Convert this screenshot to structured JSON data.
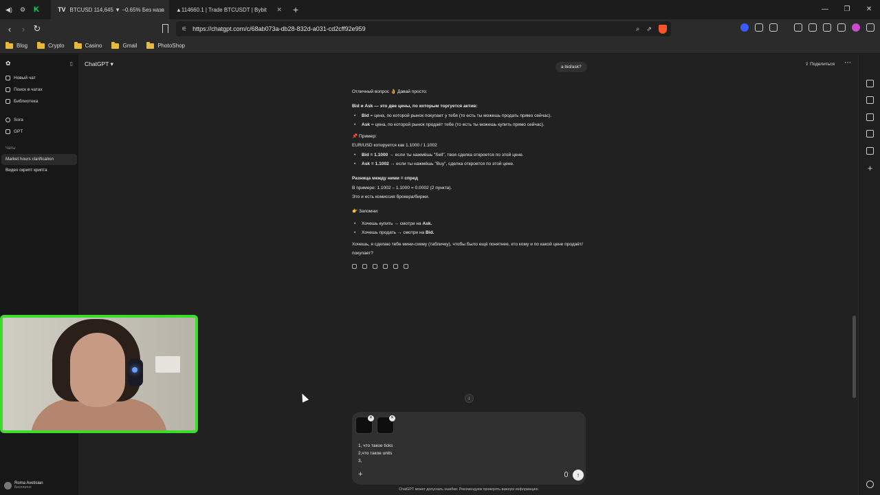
{
  "browser": {
    "tabs": [
      {
        "title": "BTCUSD 114,645 ▼ −0.65% Без назв",
        "icon": "tradingview-icon",
        "fav": "TV"
      },
      {
        "title": "▲114660.1 | Trade BTCUSDT | Bybit",
        "icon": "bybit-icon",
        "fav": ""
      }
    ],
    "url": "https://chatgpt.com/c/68ab073a-db28-832d-a031-cd2cff92e959",
    "bookmarks": [
      "Blog",
      "Crypto",
      "Casino",
      "Gmail",
      "PhotoShop"
    ],
    "window_controls": [
      "—",
      "❐",
      "✕"
    ]
  },
  "sidebar": {
    "items": [
      "Новый чат",
      "Поиск в чатах",
      "Библиотека"
    ],
    "projects": [
      "Sora",
      "GPT"
    ],
    "chats_heading": "Чаты",
    "chats": [
      "Market hours clarification",
      "Видео скрипт крипта"
    ],
    "user": {
      "name": "Roma Avetisian",
      "plan": "Бесплатно"
    }
  },
  "header": {
    "model": "ChatGPT ▾",
    "share": "⇪ Поделиться",
    "more": "⋯"
  },
  "conversation": {
    "user_message": "a bid/ask?",
    "answer": {
      "intro": "Отличный вопрос 👌 Давай просто:",
      "heading1": "Bid и Ask — это две цены, по которым торгуется актив:",
      "defs": [
        {
          "term": "Bid",
          "text": " = цена, по которой рынок покупает у тебя (то есть ты можешь продать прямо сейчас)."
        },
        {
          "term": "Ask",
          "text": " = цена, по которой рынок продаёт тебе (то есть ты можешь купить прямо сейчас)."
        }
      ],
      "example_label": "📌 Пример:",
      "example_line": "EUR/USD котируется как 1.1000 / 1.1002",
      "examples": [
        {
          "term": "Bid = 1.1000",
          "text": " → если ты нажмёшь \"Sell\", твоя сделка откроется по этой цене."
        },
        {
          "term": "Ask = 1.1002",
          "text": " → если ты нажмёшь \"Buy\", сделка откроется по этой цене."
        }
      ],
      "heading2": "Разница между ними = спред",
      "spread_line1": "В примере: 1.1002 – 1.1000 = 0.0002 (2 пункта).",
      "spread_line2": "Это и есть комиссия брокера/биржи.",
      "remember_label": "👉 Запомни:",
      "remember": [
        {
          "text": "Хочешь купить → смотри на ",
          "term": "Ask."
        },
        {
          "text": "Хочешь продать → смотри на ",
          "term": "Bid."
        }
      ],
      "offer": "Хочешь, я сделаю тебе мини-схему (табличку), чтобы было ещё понятнее, кто кому и по какой цене продаёт/покупает?"
    }
  },
  "composer": {
    "lines": [
      "1, что такое ticks",
      "2,что такое units",
      "3,"
    ],
    "attachments": 2,
    "disclaimer": "ChatGPT может допускать ошибки. Рекомендуем проверять важную информацию."
  },
  "colors": {
    "accent_green": "#3bdc2a",
    "bg": "#212121",
    "sidebar": "#171717"
  }
}
